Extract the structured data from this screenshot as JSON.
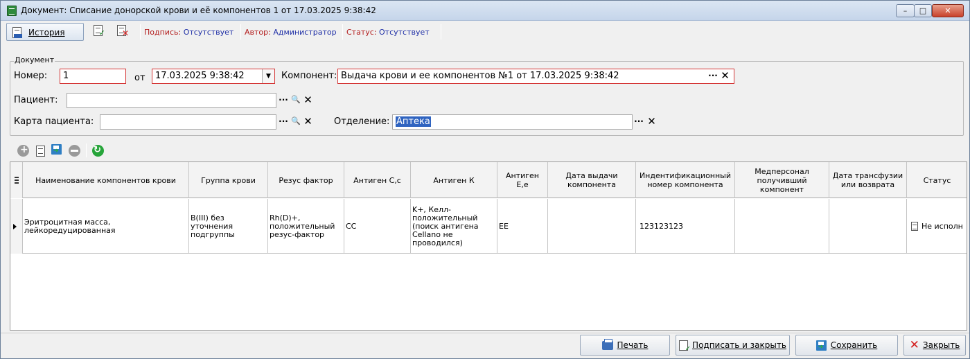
{
  "window": {
    "title": "Документ: Списание донорской крови и её компонентов 1 от 17.03.2025 9:38:42",
    "min_label": "–",
    "max_label": "□",
    "close_label": "✕"
  },
  "toolbar": {
    "history_label": "История",
    "signature_label": "Подпись:",
    "signature_value": "Отсутствует",
    "author_label": "Автор:",
    "author_value": "Администратор",
    "status_label": "Статус:",
    "status_value": "Отсутствует"
  },
  "document": {
    "group_title": "Документ",
    "number_label": "Номер:",
    "number_value": "1",
    "from_label": "от",
    "date_value": "17.03.2025 9:38:42",
    "component_label": "Компонент:",
    "component_value": "Выдача крови и ее компонентов №1 от 17.03.2025 9:38:42",
    "patient_label": "Пациент:",
    "patient_value": "",
    "card_label": "Карта пациента:",
    "card_value": "",
    "department_label": "Отделение:",
    "department_value": "Аптека"
  },
  "icons": {
    "ellipsis": "···",
    "clear": "✕",
    "search": "🔍",
    "dropdown": "▼"
  },
  "table": {
    "headers": [
      "Наименование компонентов крови",
      "Группа крови",
      "Резус фактор",
      "Антиген С,с",
      "Антиген К",
      "Антиген Е,е",
      "Дата выдачи компонента",
      "Индентификационный номер компонента",
      "Медперсонал получивший компонент",
      "Дата трансфузии или возврата",
      "Статус"
    ],
    "rows": [
      {
        "name": "Эритроцитная масса, лейкоредуцированная",
        "blood_group": "B(III) без уточнения подгруппы",
        "rhesus": "Rh(D)+, положительный резус-фактор",
        "antigen_cc": "CC",
        "antigen_k": "K+, Келл-положительный (поиск антигена Cellano не проводился)",
        "antigen_ee": "EE",
        "issue_date": "",
        "id_number": "123123123",
        "staff": "",
        "transfusion_date": "",
        "status": "Не исполн"
      }
    ]
  },
  "bottom": {
    "print_label": "Печать",
    "sign_close_label": "Подписать и закрыть",
    "save_label": "Сохранить",
    "close_label": "Закрыть"
  },
  "colors": {
    "required_border": "#d43535",
    "selection": "#3064c0",
    "label_red": "#b31d1d",
    "value_blue": "#1e2ea6"
  }
}
